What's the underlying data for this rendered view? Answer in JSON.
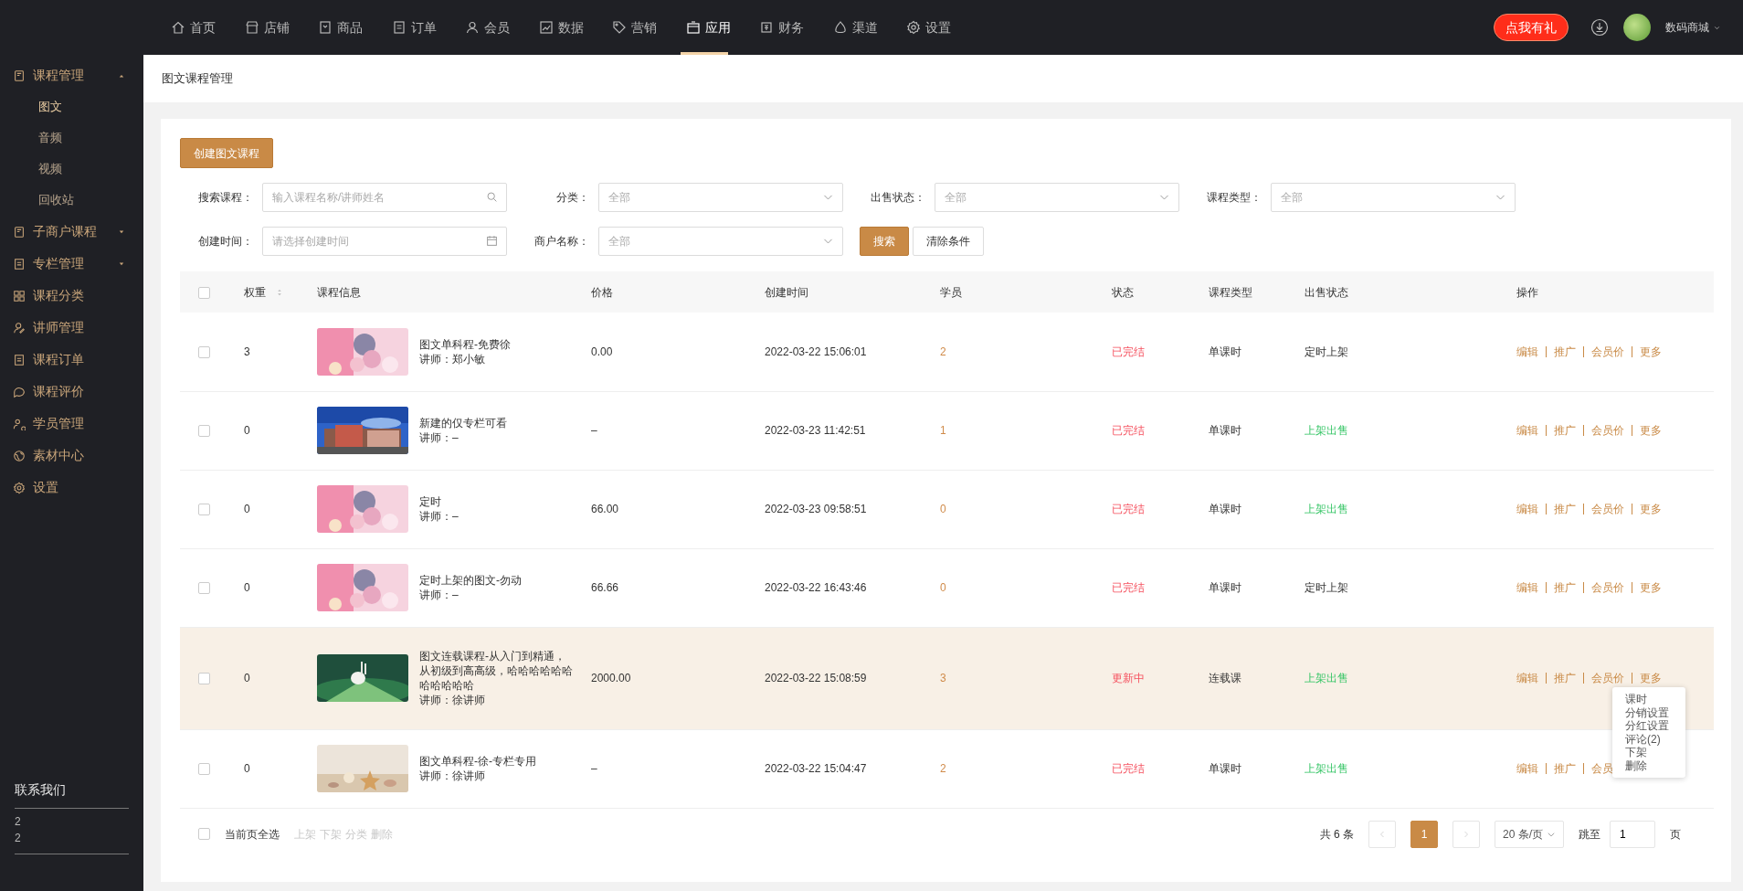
{
  "top_nav": {
    "items": [
      {
        "label": "首页",
        "selected": false
      },
      {
        "label": "店铺",
        "selected": false
      },
      {
        "label": "商品",
        "selected": false
      },
      {
        "label": "订单",
        "selected": false
      },
      {
        "label": "会员",
        "selected": false
      },
      {
        "label": "数据",
        "selected": false
      },
      {
        "label": "营销",
        "selected": false
      },
      {
        "label": "应用",
        "selected": true
      },
      {
        "label": "财务",
        "selected": false
      },
      {
        "label": "渠道",
        "selected": false
      },
      {
        "label": "设置",
        "selected": false
      }
    ],
    "gift_button": "点我有礼",
    "store_name": "数码商城"
  },
  "sidebar": {
    "items": [
      {
        "label": "课程管理",
        "expanded": true,
        "children": [
          {
            "label": "图文",
            "selected": true
          },
          {
            "label": "音频",
            "selected": false
          },
          {
            "label": "视频",
            "selected": false
          },
          {
            "label": "回收站",
            "selected": false
          }
        ]
      },
      {
        "label": "子商户课程",
        "expanded": false
      },
      {
        "label": "专栏管理",
        "expanded": false
      },
      {
        "label": "课程分类"
      },
      {
        "label": "讲师管理"
      },
      {
        "label": "课程订单"
      },
      {
        "label": "课程评价"
      },
      {
        "label": "学员管理"
      },
      {
        "label": "素材中心"
      },
      {
        "label": "设置"
      }
    ],
    "contact": {
      "title": "联系我们",
      "lines": [
        "2",
        "2"
      ]
    }
  },
  "page_title": "图文课程管理",
  "create_button": "创建图文课程",
  "filters": [
    {
      "fields": [
        {
          "label": "搜索课程：",
          "kind": "search",
          "placeholder": "输入课程名称/讲师姓名"
        },
        {
          "label": "分类：",
          "kind": "select",
          "placeholder": "全部"
        },
        {
          "label": "出售状态：",
          "kind": "select",
          "placeholder": "全部"
        },
        {
          "label": "课程类型：",
          "kind": "select",
          "placeholder": "全部"
        }
      ]
    },
    {
      "fields": [
        {
          "label": "创建时间：",
          "kind": "date",
          "placeholder": "请选择创建时间"
        },
        {
          "label": "商户名称：",
          "kind": "select",
          "placeholder": "全部"
        }
      ]
    }
  ],
  "filter_buttons": {
    "search": "搜索",
    "clear": "清除条件"
  },
  "table": {
    "all_checked": false,
    "columns": [
      "权重",
      "课程信息",
      "价格",
      "创建时间",
      "学员",
      "状态",
      "课程类型",
      "出售状态",
      "操作"
    ],
    "rows": [
      {
        "checked": false,
        "highlighted": false,
        "weight": "3",
        "thumbnail": {
          "kind": "picture"
        },
        "title": "图文单科程-免费徐",
        "teacher": "讲师：郑小敏",
        "price": "0.00",
        "created": "2022-03-22 15:06:01",
        "students": "2",
        "status": "已完结",
        "type": "单课时",
        "sale": {
          "text": "定时上架",
          "kind": "scheduled"
        },
        "actions": [
          "编辑",
          "推广",
          "会员价",
          "更多"
        ]
      },
      {
        "checked": false,
        "highlighted": false,
        "weight": "0",
        "thumbnail": {
          "kind": "picture"
        },
        "title": "新建的仅专栏可看",
        "teacher": "讲师：–",
        "price": "–",
        "created": "2022-03-23 11:42:51",
        "students": "1",
        "status": "已完结",
        "type": "单课时",
        "sale": {
          "text": "上架出售",
          "kind": "on_sale"
        },
        "actions": [
          "编辑",
          "推广",
          "会员价",
          "更多"
        ]
      },
      {
        "checked": false,
        "highlighted": false,
        "weight": "0",
        "thumbnail": {
          "kind": "picture"
        },
        "title": "定时",
        "teacher": "讲师：–",
        "price": "66.00",
        "created": "2022-03-23 09:58:51",
        "students": "0",
        "status": "已完结",
        "type": "单课时",
        "sale": {
          "text": "上架出售",
          "kind": "on_sale"
        },
        "actions": [
          "编辑",
          "推广",
          "会员价",
          "更多"
        ]
      },
      {
        "checked": false,
        "highlighted": false,
        "weight": "0",
        "thumbnail": {
          "kind": "picture"
        },
        "title": "定时上架的图文-勿动",
        "teacher": "讲师：–",
        "price": "66.66",
        "created": "2022-03-22 16:43:46",
        "students": "0",
        "status": "已完结",
        "type": "单课时",
        "sale": {
          "text": "定时上架",
          "kind": "scheduled"
        },
        "actions": [
          "编辑",
          "推广",
          "会员价",
          "更多"
        ]
      },
      {
        "checked": false,
        "highlighted": true,
        "weight": "0",
        "thumbnail": {
          "kind": "picture"
        },
        "title": "图文连载课程-从入门到精通，从初级到高高级，哈哈哈哈哈哈哈哈哈哈哈",
        "teacher": "讲师：徐讲师",
        "price": "2000.00",
        "created": "2022-03-22 15:08:59",
        "students": "3",
        "status": "更新中",
        "type": "连载课",
        "sale": {
          "text": "上架出售",
          "kind": "on_sale"
        },
        "actions": [
          "编辑",
          "推广",
          "会员价",
          "更多"
        ],
        "menu_open": true,
        "menu": [
          "课时",
          "分销设置",
          "分红设置",
          "评论(2)",
          "下架",
          "删除"
        ]
      },
      {
        "checked": false,
        "highlighted": false,
        "weight": "0",
        "thumbnail": {
          "kind": "picture"
        },
        "title": "图文单科程-徐-专栏专用",
        "teacher": "讲师：徐讲师",
        "price": "–",
        "created": "2022-03-22 15:04:47",
        "students": "2",
        "status": "已完结",
        "type": "单课时",
        "sale": {
          "text": "上架出售",
          "kind": "on_sale"
        },
        "actions": [
          "编辑",
          "推广",
          "会员"
        ]
      }
    ]
  },
  "footer": {
    "select_all": {
      "label": "当前页全选",
      "checked": false
    },
    "bulk_actions": [
      {
        "label": "上架",
        "disabled": true
      },
      {
        "label": "下架",
        "disabled": true
      },
      {
        "label": "分类",
        "disabled": true
      },
      {
        "label": "删除",
        "disabled": true
      }
    ],
    "total": "共 6 条",
    "pages": [
      {
        "label": "1",
        "selected": true
      }
    ],
    "page_size": "20 条/页",
    "jump_label": "跳至",
    "jump_value": "1",
    "page_unit": "页"
  }
}
